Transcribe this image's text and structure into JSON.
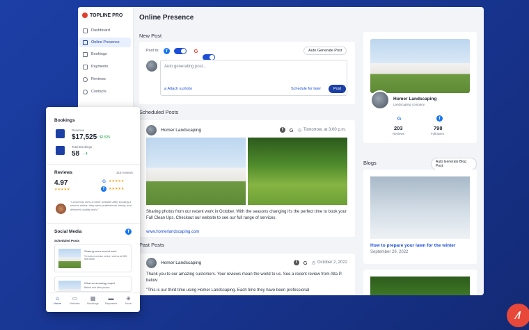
{
  "app": {
    "brand": "TOPLINE PRO",
    "page_title": "Online Presence"
  },
  "sidebar": {
    "items": [
      {
        "label": "Dashboard",
        "icon": "home-icon",
        "active": false
      },
      {
        "label": "Online Presence",
        "icon": "monitor-icon",
        "active": true
      },
      {
        "label": "Bookings",
        "icon": "calendar-icon",
        "active": false
      },
      {
        "label": "Payments",
        "icon": "card-icon",
        "active": false
      },
      {
        "label": "Reviews",
        "icon": "star-icon",
        "active": false
      },
      {
        "label": "Contacts",
        "icon": "people-icon",
        "active": false
      }
    ]
  },
  "new_post": {
    "heading": "New Post",
    "post_to": "Post to:",
    "auto_generate": "Auto Generate Post",
    "placeholder": "Auto generating post...",
    "attach": "Attach a photo",
    "schedule": "Schedule for later",
    "post": "Post"
  },
  "scheduled": {
    "heading": "Scheduled Posts",
    "author": "Homer Landscaping",
    "time": "Tomorrow, at 3:00 p.m.",
    "body": "Sharing photos from our recent work in October. With the seasons changing it's the perfect time to book your Fall Clean Ups. Checkout our website to see our full range of services.",
    "link": "www.homerlandscaping.com"
  },
  "past": {
    "heading": "Past Posts",
    "author": "Homer Landscaping",
    "date": "October 2, 2022",
    "body": "Thank you to our amazing customers. Your reviews mean the world to us. See a recent review from Alta P. below:",
    "quote": "\"This is our third time using Homer Landscaping. Each time they have been professional"
  },
  "profile": {
    "name": "Homer Landscaping",
    "subtitle": "Landscaping company",
    "reviews_count": "203",
    "reviews_label": "Reviews",
    "followers_count": "798",
    "followers_label": "Followers"
  },
  "blogs": {
    "heading": "Blogs",
    "auto_generate": "Auto Generate Blog Post",
    "title": "How to prepare your lawn for the winter",
    "date": "September 29, 2022"
  },
  "mobile": {
    "bookings_title": "Bookings",
    "revenue_label": "Revenue",
    "revenue_value": "$17,525",
    "revenue_delta": "↑ $2,525",
    "total_label": "Total Bookings",
    "total_value": "58",
    "total_delta": "↑ 4",
    "reviews_title": "Reviews",
    "reviews_count": "318 reviews",
    "rating": "4.97",
    "quote": "\"Loved this crew on their website! After booking a service online, they were professional, timely, and delivered quality work.\"",
    "social_title": "Social Media",
    "scheduled_label": "Scheduled Posts",
    "post1": "Sharing some recent work",
    "post1_sub": "To book a service online, visit us at 555-555-5555",
    "post2": "What an amazing project",
    "post2_sub": "Before and after photos",
    "tabs": [
      "Home",
      "Website",
      "Bookings",
      "Payments",
      "More"
    ]
  },
  "colors": {
    "accent": "#1c3fa6",
    "background": "#1c3fa6",
    "brand": "#e0402b"
  }
}
